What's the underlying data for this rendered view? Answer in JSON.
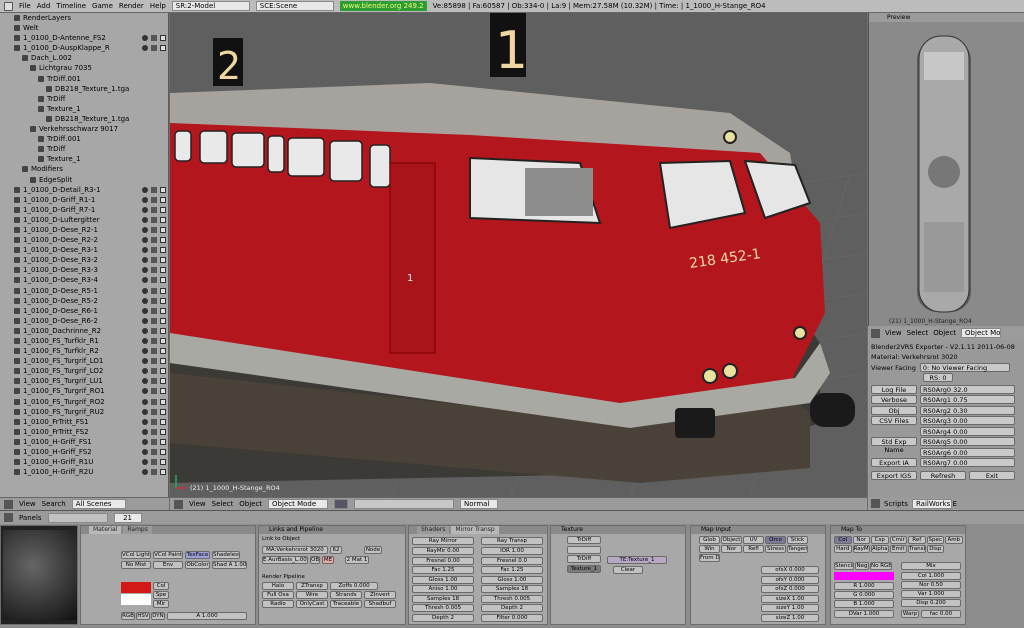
{
  "topbar": {
    "menus": [
      "File",
      "Add",
      "Timeline",
      "Game",
      "Render",
      "Help"
    ],
    "screen": "SR:2-Model",
    "scene": "SCE:Scene",
    "website": "www.blender.org 249.2",
    "stats": "Ve:85898 | Fa:60587 | Ob:334-0 | La:9 | Mem:27.58M (10.32M) | Time: | 1_1000_H-Stange_RO4"
  },
  "outliner": {
    "rows": [
      {
        "d": 1,
        "t": "RenderLayers"
      },
      {
        "d": 1,
        "t": "Welt"
      },
      {
        "d": 1,
        "t": "1_0100_D-Antenne_FS2"
      },
      {
        "d": 1,
        "t": "1_0100_D-AuspKlappe_R"
      },
      {
        "d": 2,
        "t": "Dach_L.002"
      },
      {
        "d": 3,
        "t": "Lichtgrau 7035"
      },
      {
        "d": 4,
        "t": "TrDiff.001"
      },
      {
        "d": 5,
        "t": "DB218_Texture_1.tga"
      },
      {
        "d": 4,
        "t": "TrDiff"
      },
      {
        "d": 4,
        "t": "Texture_1"
      },
      {
        "d": 5,
        "t": "DB218_Texture_1.tga"
      },
      {
        "d": 3,
        "t": "Verkehrsschwarz 9017"
      },
      {
        "d": 4,
        "t": "TrDiff.001"
      },
      {
        "d": 4,
        "t": "TrDiff"
      },
      {
        "d": 4,
        "t": "Texture_1"
      },
      {
        "d": 2,
        "t": "Modifiers"
      },
      {
        "d": 3,
        "t": "EdgeSplit"
      },
      {
        "d": 1,
        "t": "1_0100_D-Detail_R3-1"
      },
      {
        "d": 1,
        "t": "1_0100_D-Griff_R1-1"
      },
      {
        "d": 1,
        "t": "1_0100_D-Griff_R7-1"
      },
      {
        "d": 1,
        "t": "1_0100_D-Luftergitter"
      },
      {
        "d": 1,
        "t": "1_0100_D-Oese_R2-1"
      },
      {
        "d": 1,
        "t": "1_0100_D-Oese_R2-2"
      },
      {
        "d": 1,
        "t": "1_0100_D-Oese_R3-1"
      },
      {
        "d": 1,
        "t": "1_0100_D-Oese_R3-2"
      },
      {
        "d": 1,
        "t": "1_0100_D-Oese_R3-3"
      },
      {
        "d": 1,
        "t": "1_0100_D-Oese_R3-4"
      },
      {
        "d": 1,
        "t": "1_0100_D-Oese_R5-1"
      },
      {
        "d": 1,
        "t": "1_0100_D-Oese_R5-2"
      },
      {
        "d": 1,
        "t": "1_0100_D-Oese_R6-1"
      },
      {
        "d": 1,
        "t": "1_0100_D-Oese_R6-2"
      },
      {
        "d": 1,
        "t": "1_0100_Dachrinne_R2"
      },
      {
        "d": 1,
        "t": "1_0100_FS_Turfklr_R1"
      },
      {
        "d": 1,
        "t": "1_0100_FS_Turfklr_R2"
      },
      {
        "d": 1,
        "t": "1_0100_FS_Turgrif_LO1"
      },
      {
        "d": 1,
        "t": "1_0100_FS_Turgrif_LO2"
      },
      {
        "d": 1,
        "t": "1_0100_FS_Turgrif_LU1"
      },
      {
        "d": 1,
        "t": "1_0100_FS_Turgrif_RO1"
      },
      {
        "d": 1,
        "t": "1_0100_FS_Turgrif_RO2"
      },
      {
        "d": 1,
        "t": "1_0100_FS_Turgrif_RU2"
      },
      {
        "d": 1,
        "t": "1_0100_FrTritt_FS1"
      },
      {
        "d": 1,
        "t": "1_0100_FrTritt_FS2"
      },
      {
        "d": 1,
        "t": "1_0100_H-Griff_FS1"
      },
      {
        "d": 1,
        "t": "1_0100_H-Griff_FS2"
      },
      {
        "d": 1,
        "t": "1_0100_H-Griff_R1U"
      },
      {
        "d": 1,
        "t": "1_0100_H-Griff_R2U"
      }
    ],
    "header": {
      "view": "View",
      "search": "Search",
      "filter": "All Scenes"
    }
  },
  "view3d": {
    "object_label": "(21) 1_1000_H-Stange_RO4",
    "sign_left": "2",
    "sign_right": "1",
    "loco_number": "218 452-1",
    "door_number": "1",
    "header": {
      "view": "View",
      "select": "Select",
      "object": "Object",
      "mode": "Object Mode",
      "shading": "Normal"
    }
  },
  "preview": {
    "title": "Preview",
    "label": "(21) 1_1000_H-Stange_RO4"
  },
  "script": {
    "header": {
      "view": "View",
      "select": "Select",
      "object": "Object",
      "objmode": "Object Mo"
    },
    "title": "Blender2VRS Exporter - V2.1.11 2011-06-08",
    "material": "Material: Verkehrsrot 3020",
    "facing_label": "Viewer Facing",
    "facing_value": "0: No Viewer Facing",
    "rs": "RS: 0",
    "rows": [
      {
        "btn": "Log File",
        "arg": "RS0Arg0 32.0"
      },
      {
        "btn": "Verbose",
        "arg": "RS0Arg1 0.75"
      },
      {
        "btn": "Obj Hierarchy",
        "arg": "RS0Arg2 0.30"
      },
      {
        "btn": "CSV Files",
        "arg": "RS0Arg3 0.00"
      },
      {
        "btn": "",
        "arg": "RS0Arg4 0.00"
      },
      {
        "btn": "Std Exp Name",
        "arg": "RS0Arg5 0.00"
      },
      {
        "btn": "",
        "arg": "RS0Arg6 0.00"
      },
      {
        "btn": "Export IA",
        "arg": "RS0Arg7 0.00"
      }
    ],
    "bottom": [
      "Export IGS",
      "Refresh",
      "Exit"
    ],
    "footer": {
      "scripts": "Scripts",
      "workspace": "RailWorks E"
    }
  },
  "buttons": {
    "header": {
      "panels": "Panels",
      "frame": "21"
    },
    "material_tab": "Material",
    "ramps_tab": "Ramps",
    "links_title": "Links and Pipeline",
    "shaders_title": "Shaders",
    "mirror_title": "Mirror Transp",
    "texture_title": "Texture",
    "mapinput_title": "Map Input",
    "mapto_title": "Map To",
    "material_name": "MA:Verkehrsrot 3020",
    "users": "62",
    "texture_name": "TE:Texture_1",
    "tex_slots": [
      "TrDiff",
      "",
      "TrDiff",
      "Texture_1"
    ],
    "mapto_tabs": [
      "Col",
      "Nor",
      "Csp",
      "Cmir",
      "Ref",
      "Spec",
      "Amb",
      "Hard",
      "RayMir",
      "Alpha",
      "Emit",
      "TransLu",
      "Disp"
    ],
    "mapinput_tabs": [
      "Glob",
      "Object",
      "UV",
      "Orco",
      "Stick",
      "Win",
      "Nor",
      "Refl",
      "Stress",
      "Tangent",
      "From Dupli"
    ],
    "mapinput_vals": [
      "ofsX 0.000",
      "ofsY 0.000",
      "ofsZ 0.000",
      "sizeX 1.00",
      "sizeY 1.00",
      "sizeZ 1.00"
    ],
    "mapto_vals": [
      "Mix",
      "Col 1.000",
      "Nor 0.50",
      "Var 1.000",
      "Disp 0.200"
    ],
    "mapto_rgb": [
      "R 1.000",
      "G 0.000",
      "B 1.000"
    ],
    "mapto_misc": [
      "Stencil",
      "Neg",
      "No RGB",
      "DVar 1.000",
      "Warp",
      "fac 0.00"
    ],
    "shader_vals": [
      "RayMir 0.00",
      "Fresnel 0.00",
      "Fac 1.25",
      "Gloss 1.00",
      "Aniso 1.00",
      "Samples 18",
      "Thresh 0.005",
      "Depth 2"
    ],
    "transp_vals": [
      "IOR 1.00",
      "Fresnel 0.0",
      "Fac 1.25",
      "Gloss 1.00",
      "Samples 18",
      "Thresh 0.005",
      "Depth 2",
      "Filter 0.000"
    ],
    "links_vals": [
      "Link to Object",
      "Node",
      "E AurBasis_L.002",
      "OB",
      "ME",
      "2 Mat 1"
    ],
    "render_pipeline": [
      "Render Pipeline",
      "Halo",
      "ZTransp",
      "Zoffs 0.000",
      "Full Osa",
      "Wire",
      "Strands",
      "ZInvert",
      "Radio",
      "OnlyCast",
      "Traceable",
      "Shadbuf"
    ],
    "material_vals": [
      "VCol Light",
      "VCol Paint",
      "TexFace",
      "Shadeless",
      "No Mist",
      "Env",
      "ObColor",
      "Shad A 1.00",
      "Col",
      "Spe",
      "Mir",
      "RGB",
      "HSV",
      "DYN",
      "A 1.000"
    ]
  },
  "colors": {
    "loco_red": "#b3161c",
    "roof_grey": "#a6a29d",
    "underframe": "#4a4238",
    "bg": "#6d6d6d",
    "magenta": "#ff00ff"
  }
}
